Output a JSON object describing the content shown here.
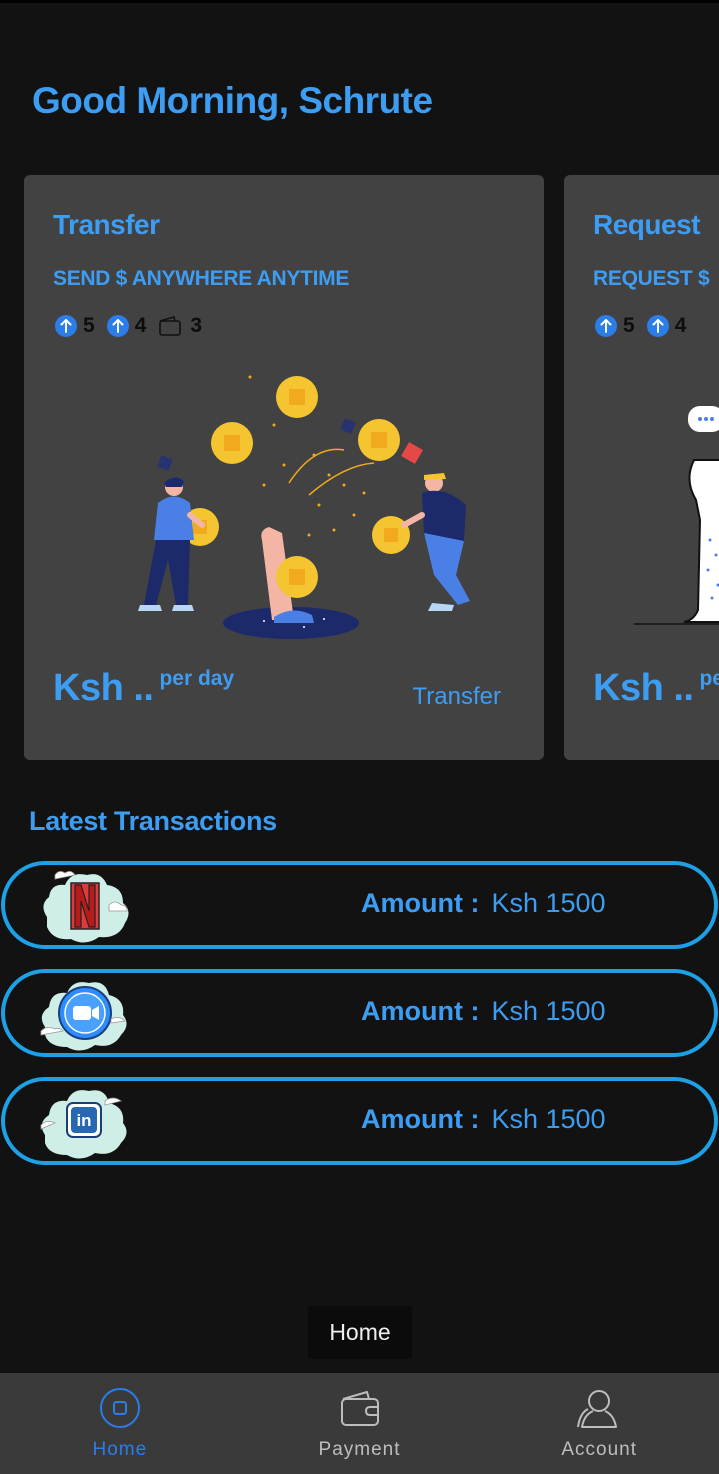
{
  "greeting": "Good Morning, Schrute",
  "cards": [
    {
      "title": "Transfer",
      "subtitle": "SEND $ ANYWHERE ANYTIME",
      "stats": [
        {
          "icon": "arrow-up-circle-icon",
          "value": "5"
        },
        {
          "icon": "arrow-up-circle-icon",
          "value": "4"
        },
        {
          "icon": "wallet-icon",
          "value": "3"
        }
      ],
      "price_main": "Ksh ..",
      "price_per": "per day",
      "action": "Transfer"
    },
    {
      "title": "Request",
      "subtitle": "REQUEST $",
      "stats": [
        {
          "icon": "arrow-up-circle-icon",
          "value": "5"
        },
        {
          "icon": "arrow-up-circle-icon",
          "value": "4"
        }
      ],
      "price_main": "Ksh ..",
      "price_per": "pe"
    }
  ],
  "transactions_title": "Latest Transactions",
  "transactions": [
    {
      "logo": "netflix-icon",
      "amount_label": "Amount :",
      "amount_value": "Ksh 1500"
    },
    {
      "logo": "zoom-icon",
      "amount_label": "Amount :",
      "amount_value": "Ksh 1500"
    },
    {
      "logo": "linkedin-icon",
      "amount_label": "Amount :",
      "amount_value": "Ksh 1500"
    }
  ],
  "toast": "Home",
  "nav": [
    {
      "label": "Home",
      "icon": "home-icon",
      "active": true
    },
    {
      "label": "Payment",
      "icon": "wallet-icon",
      "active": false
    },
    {
      "label": "Account",
      "icon": "account-icon",
      "active": false
    }
  ],
  "colors": {
    "accent": "#3d9df3",
    "active_nav": "#2b7de9",
    "transaction_border": "#1ea0e6",
    "card_bg": "#424242",
    "background": "#121212"
  }
}
